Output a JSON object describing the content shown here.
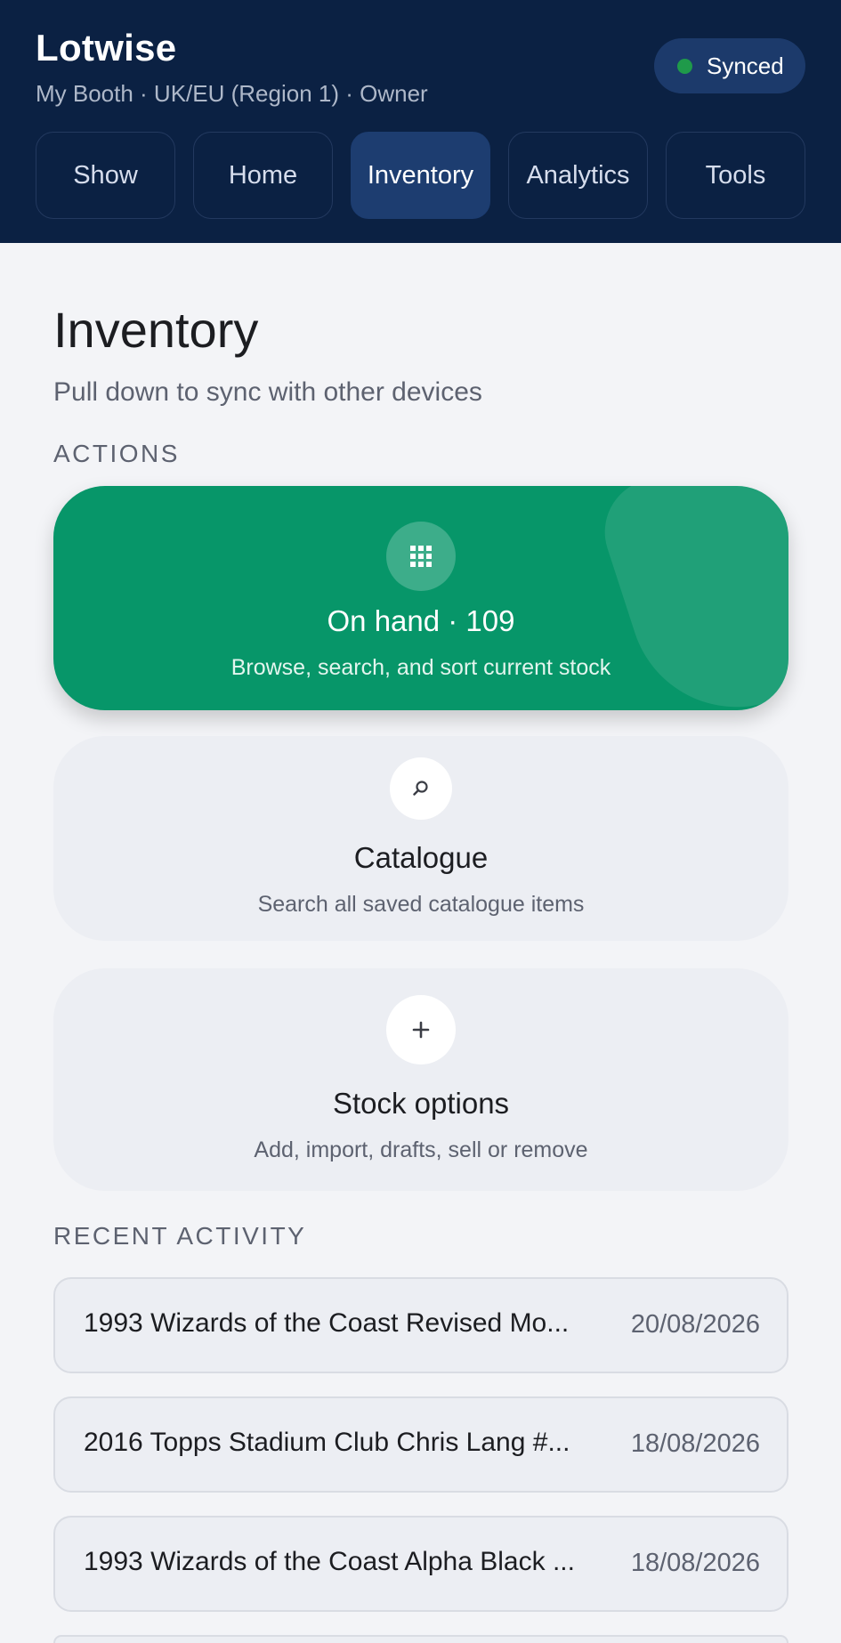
{
  "header": {
    "app_title": "Lotwise",
    "subtitle": "My Booth · UK/EU (Region 1) · Owner",
    "sync_status": "Synced",
    "sync_color": "#1f9a4a"
  },
  "tabs": [
    {
      "label": "Show",
      "active": false
    },
    {
      "label": "Home",
      "active": false
    },
    {
      "label": "Inventory",
      "active": true
    },
    {
      "label": "Analytics",
      "active": false
    },
    {
      "label": "Tools",
      "active": false
    }
  ],
  "main": {
    "title": "Inventory",
    "subtitle": "Pull down to sync with other devices",
    "actions_label": "ACTIONS",
    "recent_label": "RECENT ACTIVITY"
  },
  "actions": {
    "on_hand": {
      "title": "On hand · 109",
      "subtitle": "Browse, search, and sort current stock",
      "icon": "grid-icon",
      "color": "#079669"
    },
    "catalogue": {
      "title": "Catalogue",
      "subtitle": "Search all saved catalogue items",
      "icon": "search-icon"
    },
    "stock_options": {
      "title": "Stock options",
      "subtitle": "Add, import, drafts, sell or remove",
      "icon": "plus-icon"
    }
  },
  "recent": [
    {
      "name": "1993 Wizards of the Coast Revised Mo...",
      "date": "20/08/2026"
    },
    {
      "name": "2016 Topps Stadium Club Chris Lang #...",
      "date": "18/08/2026"
    },
    {
      "name": "1993 Wizards of the Coast Alpha Black ...",
      "date": "18/08/2026"
    }
  ]
}
